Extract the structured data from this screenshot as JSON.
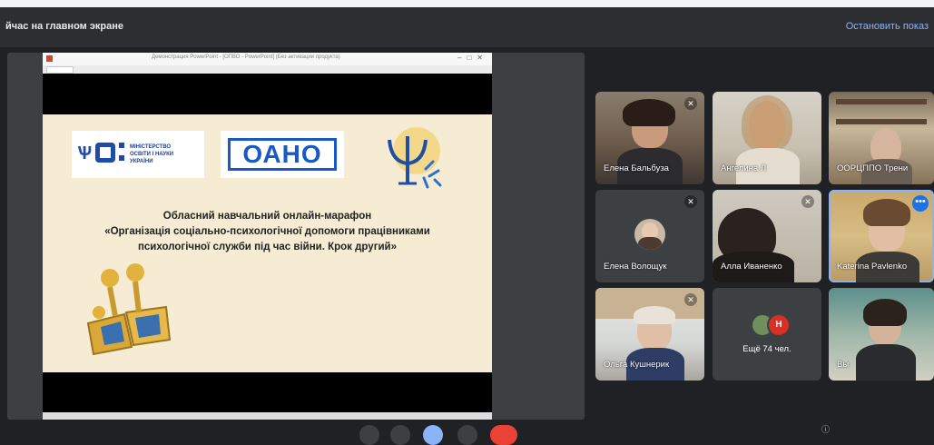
{
  "header": {
    "presenting_text": "йчас на главном экране",
    "stop_label": "Остановить показ"
  },
  "ppt_window": {
    "title": "Демонстрация PowerPoint - [ОПВО - PowerPoint] (Без активации продукта)"
  },
  "slide": {
    "ministry_logo_text": "МІНІСТЕРСТВО\nОСВІТИ І НАУКИ\nУКРАЇНИ",
    "oano_logo_text": "ОАНО",
    "lines": [
      "Обласний навчальний онлайн-марафон",
      "«Організація соціально-психологічної допомоги працівниками",
      "психологічної служби під час війни. Крок другий»"
    ]
  },
  "participants": [
    {
      "name": "Елена Бальбуза",
      "muted": true
    },
    {
      "name": "Ангелина Л",
      "muted": false
    },
    {
      "name": "ООРЦППО Трени",
      "muted": false
    },
    {
      "name": "Елена Волощук",
      "muted": true
    },
    {
      "name": "Алла Иваненко",
      "muted": true
    },
    {
      "name": "Katerina Pavlenko",
      "muted": false
    },
    {
      "name": "Ольга Кушнерик",
      "muted": true
    },
    {
      "name": "Вы",
      "muted": false
    }
  ],
  "more_tile": {
    "avatar_letter": "Н",
    "count_text": "Ещё 74 чел."
  },
  "icons": {
    "mic_off": "mic-off-icon",
    "more": "more-options-icon"
  },
  "colors": {
    "background": "#202124",
    "tile": "#3c4043",
    "accent": "#8ab4f8",
    "red": "#ea4335"
  }
}
